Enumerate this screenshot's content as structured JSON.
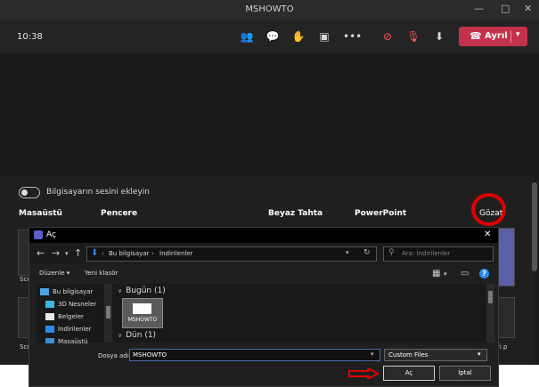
{
  "window": {
    "title": "MSHOWTO"
  },
  "topbar": {
    "time": "10:38",
    "leave_label": "Ayrıl"
  },
  "share": {
    "include_audio_label": "Bilgisayarın sesini ekleyin",
    "categories": [
      "Masaüstü",
      "Pencere",
      "Beyaz Tahta",
      "PowerPoint"
    ],
    "browse_label": "Gözat",
    "thumb_captions": [
      "Scr",
      "Scr",
      "ri.p"
    ]
  },
  "dialog": {
    "title": "Aç",
    "path": [
      "Bu bilgisayar",
      "İndirilenler"
    ],
    "search_placeholder": "Ara: İndirilenler",
    "organize_label": "Düzenle ▾",
    "new_folder_label": "Yeni klasör",
    "nav_items": [
      "Bu bilgisayar",
      "3D Nesneler",
      "Belgeler",
      "İndirilenler",
      "Masaüstü"
    ],
    "groups": [
      {
        "label": "Bugün (1)"
      },
      {
        "label": "Dün (1)"
      }
    ],
    "file_name": "MSHOWTO",
    "filename_label": "Dosya adı:",
    "filename_value": "MSHOWTO",
    "filetype_value": "Custom Files",
    "open_label": "Aç",
    "cancel_label": "İptal"
  },
  "colors": {
    "accent": "#c4314b",
    "highlight": "#e00000",
    "folder_blue": "#2b8ce8"
  }
}
